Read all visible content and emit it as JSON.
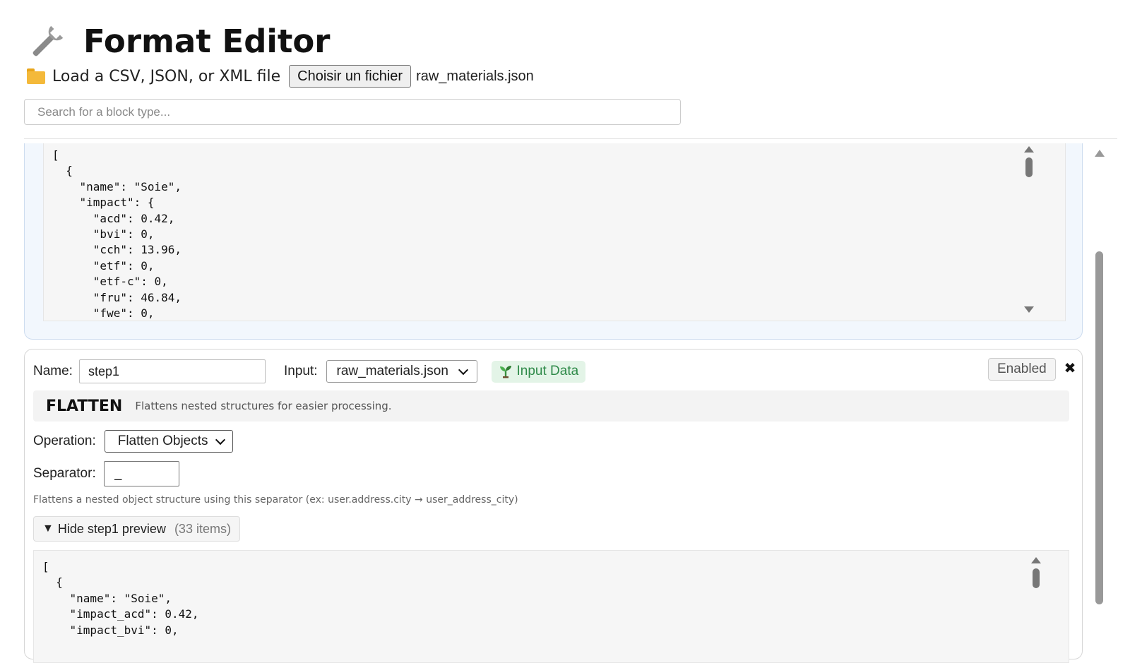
{
  "header": {
    "title": "Format Editor",
    "icon": "wrench-icon"
  },
  "loader": {
    "label": "Load a CSV, JSON, or XML file",
    "button_label": "Choisir un fichier",
    "file_name": "raw_materials.json",
    "icon": "folder-icon"
  },
  "search": {
    "placeholder": "Search for a block type..."
  },
  "input_block": {
    "code": "[\n  {\n    \"name\": \"Soie\",\n    \"impact\": {\n      \"acd\": 0.42,\n      \"bvi\": 0,\n      \"cch\": 13.96,\n      \"etf\": 0,\n      \"etf-c\": 0,\n      \"fru\": 46.84,\n      \"fwe\": 0,"
  },
  "step": {
    "name_label": "Name:",
    "name_value": "step1",
    "input_label": "Input:",
    "input_selected": "raw_materials.json",
    "input_badge": "Input Data",
    "enabled_label": "Enabled",
    "close_label": "✖",
    "type_name": "FLATTEN",
    "type_desc": "Flattens nested structures for easier processing.",
    "operation_label": "Operation:",
    "operation_selected": "Flatten Objects",
    "separator_label": "Separator:",
    "separator_value": "_",
    "help_text": "Flattens a nested object structure using this separator (ex: user.address.city → user_address_city)",
    "preview_toggle_label": "Hide step1 preview",
    "preview_count": "(33 items)",
    "preview_code": "[\n  {\n    \"name\": \"Soie\",\n    \"impact_acd\": 0.42,\n    \"impact_bvi\": 0,"
  },
  "colors": {
    "badge_bg": "#e3f4e7",
    "badge_text": "#2f8a49",
    "input_block_bg": "#f2f7fd"
  }
}
